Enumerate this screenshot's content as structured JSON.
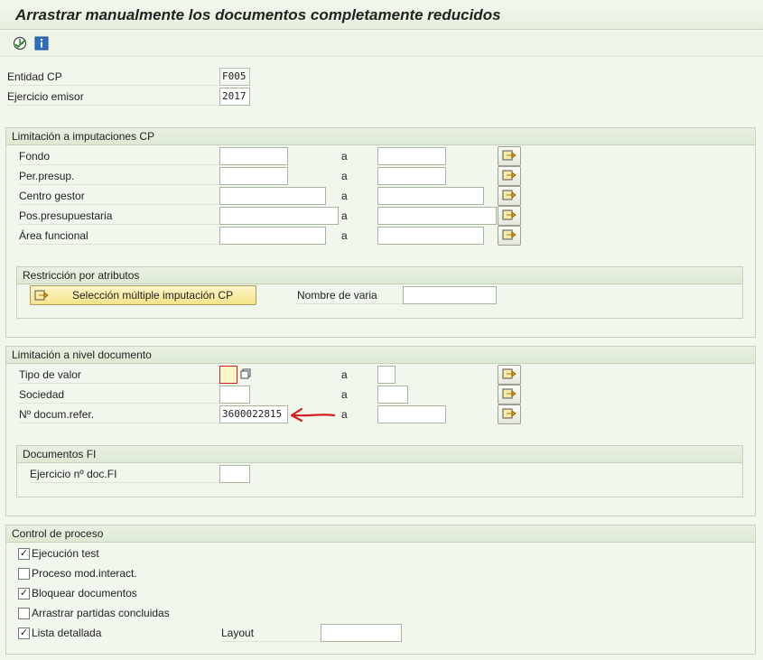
{
  "title": "Arrastrar manualmente los documentos completamente reducidos",
  "toolbar": {
    "execute_icon": "execute-icon",
    "info_icon": "info-icon"
  },
  "header": {
    "entidad_label": "Entidad CP",
    "entidad_value": "F005",
    "ejercicio_label": "Ejercicio emisor",
    "ejercicio_value": "2017"
  },
  "group_cp": {
    "title": "Limitación a imputaciones CP",
    "rows": [
      {
        "label": "Fondo",
        "to": "a"
      },
      {
        "label": "Per.presup.",
        "to": "a"
      },
      {
        "label": "Centro gestor",
        "to": "a"
      },
      {
        "label": "Pos.presupuestaria",
        "to": "a"
      },
      {
        "label": "Área funcional",
        "to": "a"
      }
    ],
    "restriccion": {
      "title": "Restricción por atributos",
      "button": "Selección múltiple imputación CP",
      "nombre_label": "Nombre de varia",
      "nombre_value": ""
    }
  },
  "group_doc": {
    "title": "Limitación a nivel documento",
    "rows": [
      {
        "label": "Tipo de valor",
        "from": "",
        "to": "a"
      },
      {
        "label": "Sociedad",
        "from": "",
        "to": "a"
      },
      {
        "label": "Nº docum.refer.",
        "from": "3600022815",
        "to": "a"
      }
    ],
    "fi": {
      "title": "Documentos FI",
      "ejercicio_label": "Ejercicio nº doc.FI",
      "ejercicio_value": ""
    }
  },
  "group_proc": {
    "title": "Control de proceso",
    "items": [
      {
        "label": "Ejecución test",
        "checked": true
      },
      {
        "label": "Proceso mod.interact.",
        "checked": false
      },
      {
        "label": "Bloquear documentos",
        "checked": true
      },
      {
        "label": "Arrastrar partidas concluidas",
        "checked": false
      },
      {
        "label": "Lista detallada",
        "checked": true
      }
    ],
    "layout_label": "Layout",
    "layout_value": ""
  },
  "colors": {
    "accent_red": "#d42020",
    "button_yellow": "#f5e48c"
  }
}
